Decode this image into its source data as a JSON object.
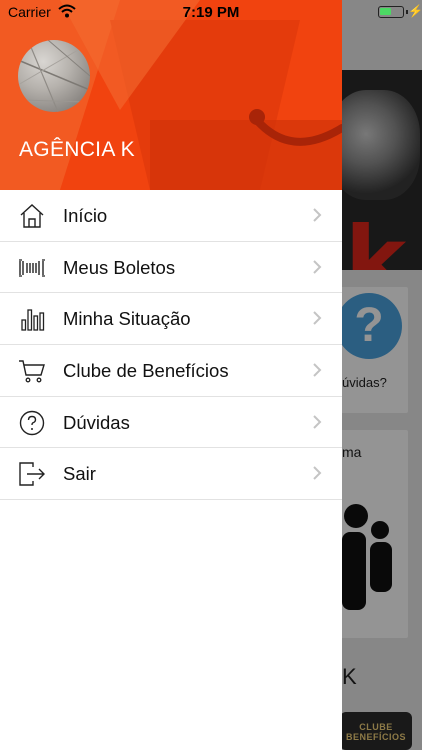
{
  "status_bar": {
    "carrier": "Carrier",
    "time": "7:19 PM",
    "battery_color": "#4cd964"
  },
  "drawer": {
    "header_color": "#f1430f",
    "agency_name": "AGÊNCIA K",
    "menu": [
      {
        "label": "Início",
        "icon": "home-icon"
      },
      {
        "label": "Meus Boletos",
        "icon": "barcode-icon"
      },
      {
        "label": "Minha Situação",
        "icon": "bar-chart-icon"
      },
      {
        "label": "Clube de Benefícios",
        "icon": "cart-icon"
      },
      {
        "label": "Dúvidas",
        "icon": "question-circle-icon"
      },
      {
        "label": "Sair",
        "icon": "exit-icon"
      }
    ]
  },
  "background_app": {
    "card1_label": "úvidas?",
    "card2_label": "ma",
    "bottom_text": "K",
    "badge_text": "CLUBE BENEFÍCIOS"
  }
}
